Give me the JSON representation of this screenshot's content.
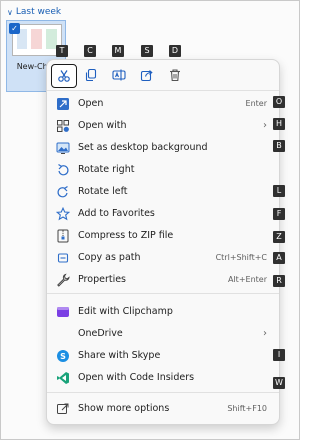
{
  "explorer": {
    "group_label": "Last week",
    "file_name": "New-Ch..."
  },
  "quick_actions": [
    {
      "name": "cut",
      "key": "T"
    },
    {
      "name": "copy",
      "key": "C"
    },
    {
      "name": "rename",
      "key": "M"
    },
    {
      "name": "share",
      "key": "S"
    },
    {
      "name": "delete",
      "key": "D"
    }
  ],
  "menu": {
    "items": [
      {
        "label": "Open",
        "shortcut": "Enter",
        "key": "O",
        "icon": "open-icon"
      },
      {
        "label": "Open with",
        "key": "H",
        "icon": "open-with-icon",
        "submenu": true
      },
      {
        "label": "Set as desktop background",
        "key": "B",
        "icon": "desktop-background-icon"
      },
      {
        "label": "Rotate right",
        "icon": "rotate-right-icon"
      },
      {
        "label": "Rotate left",
        "key": "L",
        "icon": "rotate-left-icon"
      },
      {
        "label": "Add to Favorites",
        "key": "F",
        "icon": "star-icon"
      },
      {
        "label": "Compress to ZIP file",
        "key": "Z",
        "icon": "zip-icon"
      },
      {
        "label": "Copy as path",
        "shortcut": "Ctrl+Shift+C",
        "key": "A",
        "icon": "copy-path-icon"
      },
      {
        "label": "Properties",
        "shortcut": "Alt+Enter",
        "key": "R",
        "icon": "wrench-icon"
      },
      {
        "label": "Edit with Clipchamp",
        "icon": "clipchamp-icon"
      },
      {
        "label": "OneDrive",
        "submenu": true
      },
      {
        "label": "Share with Skype",
        "key": "I",
        "icon": "skype-icon"
      },
      {
        "label": "Open with Code Insiders",
        "key": "W",
        "icon": "vscode-insiders-icon"
      },
      {
        "label": "Show more options",
        "shortcut": "Shift+F10",
        "icon": "more-options-icon"
      }
    ]
  },
  "colors": {
    "accent": "#1a66c9",
    "key_badge": "#303030",
    "selection": "#cfe1f6"
  }
}
